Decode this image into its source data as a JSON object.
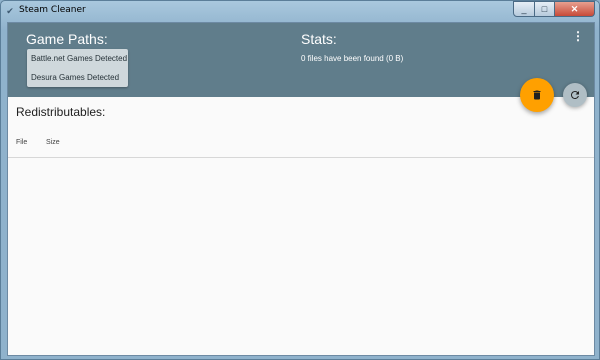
{
  "window": {
    "title": "Steam Cleaner",
    "controls": {
      "minimize": "_",
      "maximize": "□",
      "close": "✕"
    }
  },
  "header": {
    "game_paths_title": "Game Paths:",
    "detected": [
      {
        "label": "Battle.net Games Detected"
      },
      {
        "label": "Desura Games Detected"
      }
    ],
    "stats_title": "Stats:",
    "stats_text": "0 files have been found (0 B)",
    "menu_icon": "more-vert-icon"
  },
  "actions": {
    "delete_icon": "trash-icon",
    "refresh_icon": "refresh-icon",
    "colors": {
      "delete_fab": "#ffa000",
      "refresh_fab": "#b0bec5",
      "header_bg": "#607d8b"
    }
  },
  "redistributables": {
    "title": "Redistributables:",
    "columns": [
      "File",
      "Size"
    ],
    "rows": []
  }
}
